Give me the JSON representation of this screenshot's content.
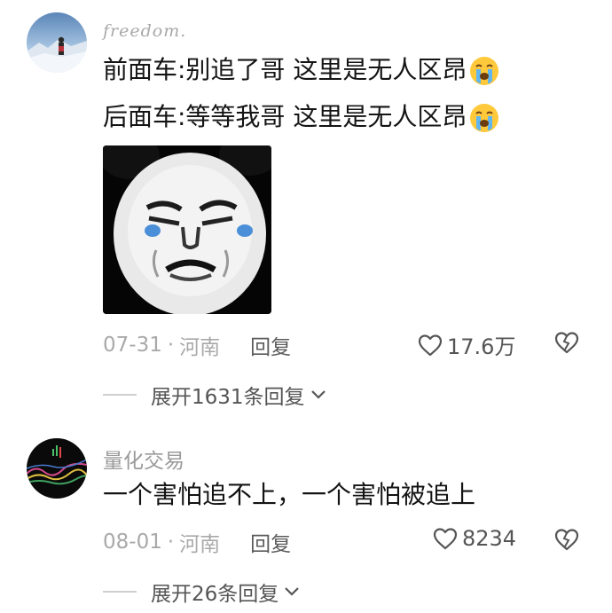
{
  "comments": [
    {
      "username": "freedom.",
      "lines": [
        "前面车:别追了哥 这里是无人区昂",
        "后面车:等等我哥 这里是无人区昂"
      ],
      "line_emoji": "crying-face-emoji",
      "sticker": "panda-face-meme-sticker",
      "date": "07-31",
      "separator": "·",
      "location": "河南",
      "reply_label": "回复",
      "like_count": "17.6万",
      "expand_label": "展开1631条回复"
    },
    {
      "username": "量化交易",
      "lines": [
        "一个害怕追不上，一个害怕被追上"
      ],
      "date": "08-01",
      "separator": "·",
      "location": "河南",
      "reply_label": "回复",
      "like_count": "8234",
      "expand_label": "展开26条回复"
    }
  ],
  "icons": {
    "like": "heart-outline-icon",
    "dislike": "broken-heart-icon",
    "expand": "chevron-down-icon"
  },
  "colors": {
    "text": "#141414",
    "meta": "#a9a9a9",
    "action": "#555555"
  }
}
